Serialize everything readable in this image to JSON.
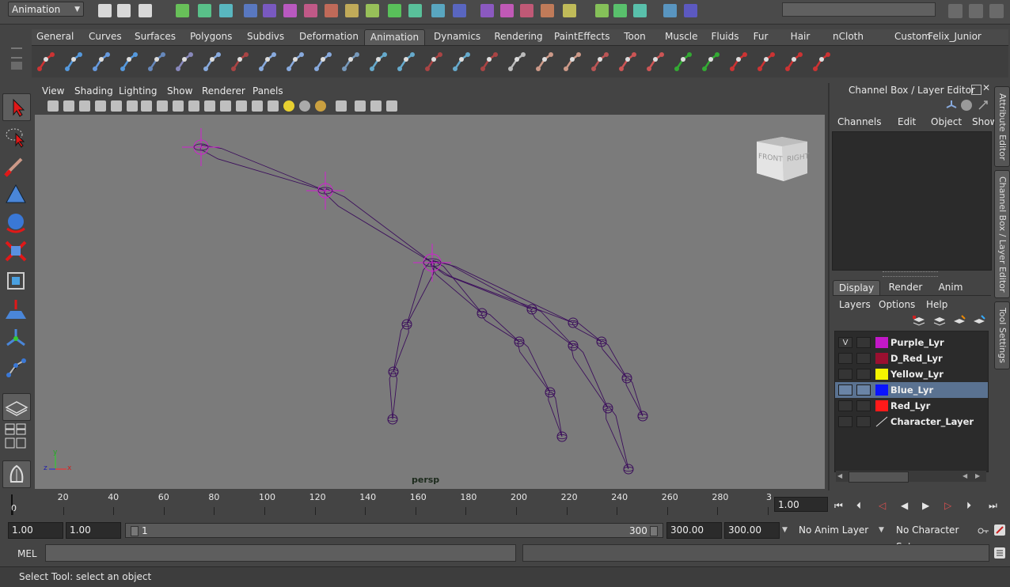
{
  "status_line": {
    "menu_set": "Animation"
  },
  "shelf": {
    "tabs": [
      "General",
      "Curves",
      "Surfaces",
      "Polygons",
      "Subdivs",
      "Deformation",
      "Animation",
      "Dynamics",
      "Rendering",
      "PaintEffects",
      "Toon",
      "Muscle",
      "Fluids",
      "Fur",
      "Hair",
      "nCloth",
      "Custom",
      "Felix_Junior"
    ],
    "active_tab": "Animation"
  },
  "viewport": {
    "menus": [
      "View",
      "Shading",
      "Lighting",
      "Show",
      "Renderer",
      "Panels"
    ],
    "camera": "persp",
    "view_cube": {
      "front": "FRONT",
      "right": "RIGHT"
    },
    "axis": {
      "x": "x",
      "y": "y",
      "z": "z"
    }
  },
  "channel_box": {
    "title": "Channel Box / Layer Editor",
    "menus": [
      "Channels",
      "Edit",
      "Object",
      "Show"
    ]
  },
  "side_tabs": [
    "Attribute Editor",
    "Channel Box / Layer Editor",
    "Tool Settings"
  ],
  "layer_editor": {
    "tabs": [
      "Display",
      "Render",
      "Anim"
    ],
    "active_tab": "Display",
    "menus": [
      "Layers",
      "Options",
      "Help"
    ],
    "layers": [
      {
        "visible": "V",
        "color": "#c218c8",
        "name": "Purple_Lyr",
        "selected": false
      },
      {
        "visible": "",
        "color": "#9a1030",
        "name": "D_Red_Lyr",
        "selected": false
      },
      {
        "visible": "",
        "color": "#f5f500",
        "name": "Yellow_Lyr",
        "selected": false
      },
      {
        "visible": "",
        "color": "#0a14ff",
        "name": "Blue_Lyr",
        "selected": true
      },
      {
        "visible": "",
        "color": "#ff1a1a",
        "name": "Red_Lyr",
        "selected": false
      },
      {
        "visible": "",
        "color": "",
        "name": "Character_Layer",
        "selected": false
      }
    ]
  },
  "time_slider": {
    "ticks": [
      "0",
      "20",
      "40",
      "60",
      "80",
      "100",
      "120",
      "140",
      "160",
      "180",
      "200",
      "220",
      "240",
      "260",
      "280",
      "3"
    ],
    "start_frame": "0",
    "current_time": "1.00"
  },
  "range_slider": {
    "start_time": "1.00",
    "playback_start": "1.00",
    "range_start": "1",
    "range_end": "300",
    "playback_end": "300.00",
    "end_time": "300.00",
    "anim_layer": "No Anim Layer",
    "character_set": "No Character Set"
  },
  "command_line": {
    "label": "MEL"
  },
  "help_line": {
    "text": "Select Tool: select an object"
  },
  "colors": {
    "joint_wire": "#3c0f5c",
    "joint_highlight": "#d020d0",
    "viewport_bg": "#7b7b7b",
    "selected_row": "#5a7291"
  }
}
